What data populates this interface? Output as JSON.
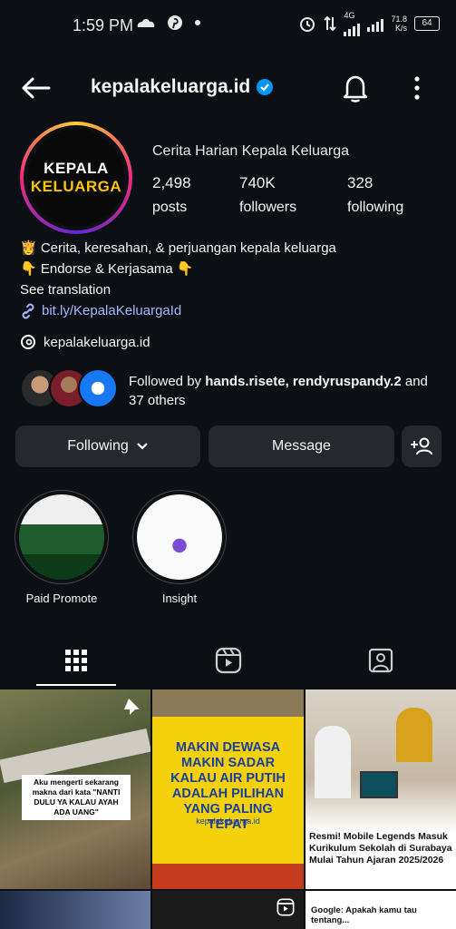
{
  "status_bar": {
    "time": "1:59 PM",
    "network_speed": "71.8",
    "network_unit": "K/s",
    "network_type": "4G",
    "battery": "64"
  },
  "header": {
    "username": "kepalakeluarga.id"
  },
  "profile": {
    "avatar_line1": "KEPALA",
    "avatar_line2": "KELUARGA",
    "full_name": "Cerita Harian Kepala Keluarga",
    "stats": [
      {
        "value": "2,498",
        "label": "posts"
      },
      {
        "value": "740K",
        "label": "followers"
      },
      {
        "value": "328",
        "label": "following"
      }
    ],
    "bio_lines": [
      "👸 Cerita, keresahan, & perjuangan kepala keluarga",
      "👇 Endorse & Kerjasama 👇"
    ],
    "see_translation": "See translation",
    "link": "bit.ly/KepalaKeluargaId",
    "threads_handle": "kepalakeluarga.id",
    "followed_by_prefix": "Followed by ",
    "followed_by_names": "hands.risete, rendyruspandy.2",
    "followed_by_suffix": " and",
    "followed_by_others": "37 others"
  },
  "actions": {
    "following_label": "Following",
    "message_label": "Message"
  },
  "highlights": [
    {
      "label": "Paid Promote"
    },
    {
      "label": "Insight"
    }
  ],
  "posts": [
    {
      "caption": "Aku mengerti sekarang makna dari kata \"NANTI DULU YA KALAU AYAH ADA UANG\""
    },
    {
      "caption": "MAKIN DEWASA MAKIN SADAR KALAU AIR PUTIH ADALAH PILIHAN YANG PALING TEPAT",
      "footer": "kepalakeluarga.id"
    },
    {
      "caption": "Resmi! Mobile Legends Masuk Kurikulum Sekolah di Surabaya Mulai Tahun Ajaran 2025/2026"
    },
    {
      "caption": "Google: Apakah kamu tau tentang..."
    }
  ],
  "colors": {
    "background": "#0c1014",
    "button_bg": "#25292e",
    "link": "#a5b6ff",
    "verified": "#0095f6",
    "brand_yellow": "#f6c400"
  }
}
